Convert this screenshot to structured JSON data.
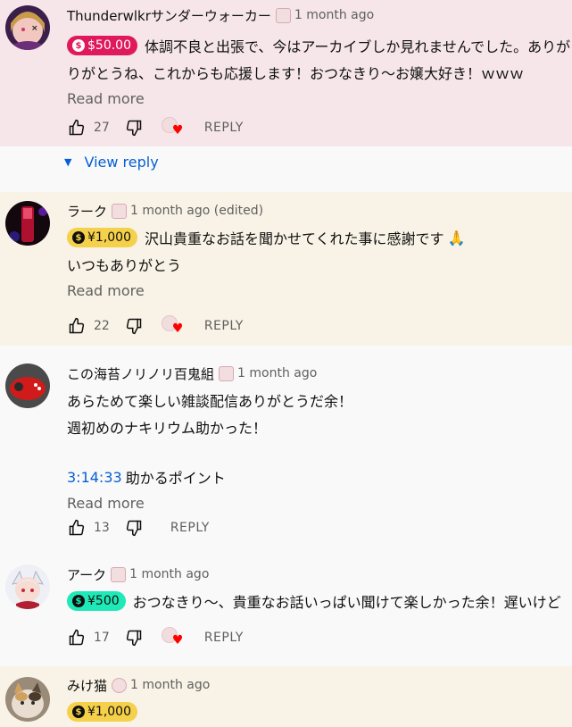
{
  "comments": [
    {
      "author": "Thunderwlkrサンダーウォーカー",
      "time": "1 month ago",
      "chip": "$50.00",
      "lines": [
        "体調不良と出張で、今はアーカイブしか見れませんでした。ありがとうね、",
        "りがとうね、これからも応援します！おつなきり～お嬢大好き！ｗｗｗ"
      ],
      "read_more": "Read more",
      "likes": "27",
      "reply": "REPLY",
      "view_reply": "View reply"
    },
    {
      "author": "ラーク",
      "time": "1 month ago (edited)",
      "chip": "¥1,000",
      "lines": [
        "沢山貴重なお話を聞かせてくれた事に感謝です",
        "いつもありがとう"
      ],
      "emoji": "🙏",
      "read_more": "Read more",
      "likes": "22",
      "reply": "REPLY"
    },
    {
      "author": "この海苔ノリノリ百鬼組",
      "time": "1 month ago",
      "lines": [
        "あらためて楽しい雑談配信ありがとうだ余！",
        "週初めのナキリウム助かった！"
      ],
      "timestamp": "3:14:33",
      "timestamp_text": "助かるポイント",
      "read_more": "Read more",
      "likes": "13",
      "reply": "REPLY"
    },
    {
      "author": "アーク",
      "time": "1 month ago",
      "chip": "¥500",
      "lines": [
        "おつなきり～、貴重なお話いっぱい聞けて楽しかった余！遅いけど"
      ],
      "likes": "17",
      "reply": "REPLY"
    },
    {
      "author": "みけ猫",
      "time": "1 month ago",
      "chip": "¥1,000"
    }
  ],
  "chip_colors": {
    "red": "#e0195d",
    "gold": "#f5d04a",
    "teal": "#1fe9b6"
  },
  "link_color": "#065fd4"
}
